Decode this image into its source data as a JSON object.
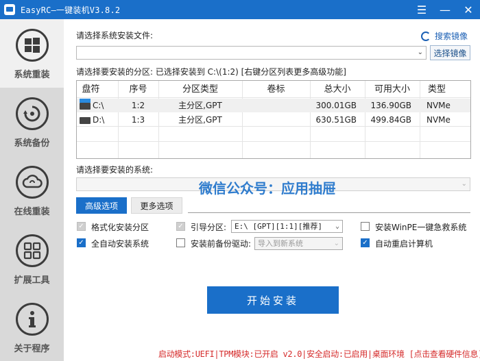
{
  "window": {
    "title": "EasyRC—一键装机V3.8.2",
    "menu_glyph": "☰",
    "min_glyph": "—",
    "close_glyph": "✕"
  },
  "sidebar": {
    "items": [
      {
        "label": "系统重装",
        "icon": "windows-icon",
        "active": true
      },
      {
        "label": "系统备份",
        "icon": "backup-icon",
        "active": false
      },
      {
        "label": "在线重装",
        "icon": "cloud-icon",
        "active": false
      },
      {
        "label": "扩展工具",
        "icon": "apps-icon",
        "active": false
      },
      {
        "label": "关于程序",
        "icon": "info-icon",
        "active": false
      }
    ]
  },
  "image_section": {
    "label": "请选择系统安装文件:",
    "search_link": "搜索镜像",
    "select_button": "选择镜像",
    "value": ""
  },
  "partition_section": {
    "label": "请选择要安装的分区: 已选择安装到 C:\\(1:2) [右键分区列表更多高级功能]",
    "columns": [
      "盘符",
      "序号",
      "分区类型",
      "卷标",
      "总大小",
      "可用大小",
      "类型"
    ],
    "rows": [
      {
        "drive": "C:\\",
        "index": "1:2",
        "ptype": "主分区,GPT",
        "label": "",
        "total": "300.01GB",
        "free": "136.90GB",
        "type": "NVMe"
      },
      {
        "drive": "D:\\",
        "index": "1:3",
        "ptype": "主分区,GPT",
        "label": "",
        "total": "630.51GB",
        "free": "499.84GB",
        "type": "NVMe"
      }
    ]
  },
  "system_section": {
    "label": "请选择要安装的系统:",
    "value": ""
  },
  "watermark": "微信公众号：应用抽屉",
  "tabs": {
    "advanced": "高级选项",
    "more": "更多选项"
  },
  "options": {
    "format": {
      "label": "格式化安装分区",
      "checked": true,
      "disabled": true
    },
    "boot_partition": {
      "label": "引导分区:",
      "checked": true,
      "disabled": true,
      "value": "E:\\ [GPT][1:1][推荐]"
    },
    "winpe": {
      "label": "安装WinPE一键急救系统",
      "checked": false
    },
    "auto_install": {
      "label": "全自动安装系统",
      "checked": true
    },
    "backup_driver": {
      "label": "安装前备份驱动:",
      "checked": false,
      "value": "导入到新系统"
    },
    "auto_reboot": {
      "label": "自动重启计算机",
      "checked": true
    }
  },
  "start_button": "开始安装",
  "status_bar": "启动模式:UEFI|TPM模块:已开启 v2.0|安全启动:已启用|桌面环境 [点击查看硬件信息]",
  "colors": {
    "accent": "#1a6fc9",
    "status": "#d52b2b",
    "sidebar": "#d9d9d9"
  }
}
